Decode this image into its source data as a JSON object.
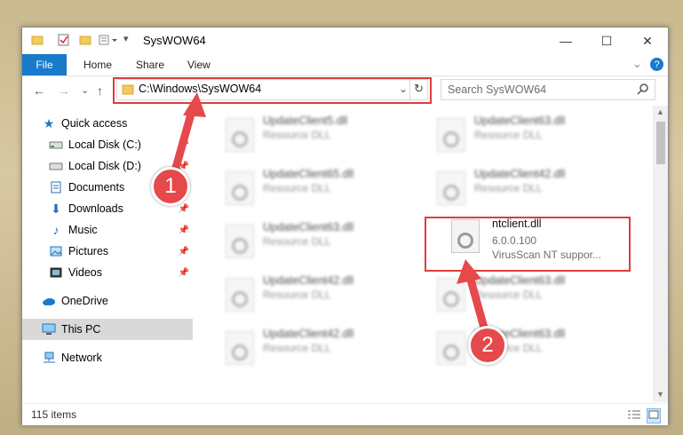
{
  "window": {
    "title": "SysWOW64",
    "minimize_symbol": "—",
    "maximize_symbol": "☐",
    "close_symbol": "✕"
  },
  "ribbon": {
    "file_tab": "File",
    "tabs": [
      "Home",
      "Share",
      "View"
    ],
    "expand_symbol": "⌄",
    "help_symbol": "?"
  },
  "nav": {
    "back_symbol": "←",
    "forward_symbol": "→",
    "recent_symbol": "⌄",
    "up_symbol": "↑",
    "address": "C:\\Windows\\SysWOW64",
    "dropdown_symbol": "⌄",
    "refresh_symbol": "↻",
    "search_placeholder": "Search SysWOW64"
  },
  "sidebar": {
    "items": [
      {
        "label": "Quick access",
        "icon": "star-icon",
        "pinned": false
      },
      {
        "label": "Local Disk (C:)",
        "icon": "drive-icon",
        "pinned": true
      },
      {
        "label": "Local Disk (D:)",
        "icon": "drive-icon",
        "pinned": true
      },
      {
        "label": "Documents",
        "icon": "documents-icon",
        "pinned": true
      },
      {
        "label": "Downloads",
        "icon": "downloads-icon",
        "pinned": true
      },
      {
        "label": "Music",
        "icon": "music-icon",
        "pinned": true
      },
      {
        "label": "Pictures",
        "icon": "pictures-icon",
        "pinned": true
      },
      {
        "label": "Videos",
        "icon": "videos-icon",
        "pinned": true
      },
      {
        "label": "OneDrive",
        "icon": "cloud-icon",
        "pinned": false
      },
      {
        "label": "This PC",
        "icon": "computer-icon",
        "pinned": false,
        "selected": true
      },
      {
        "label": "Network",
        "icon": "network-icon",
        "pinned": false
      }
    ]
  },
  "files": [
    {
      "name": "UpdateClient5.dll",
      "desc": "Resource DLL"
    },
    {
      "name": "UpdateClient63.dll",
      "desc": "Resource DLL"
    },
    {
      "name": "UpdateClient65.dll",
      "desc": "Resource DLL"
    },
    {
      "name": "UpdateClient42.dll",
      "desc": "Resource DLL"
    },
    {
      "name": "UpdateClient63.dll",
      "desc": "Resource DLL"
    },
    {
      "name": "ntclient.dll",
      "version": "6.0.0.100",
      "desc": "VirusScan NT suppor..."
    },
    {
      "name": "UpdateClient42.dll",
      "desc": "Resource DLL"
    },
    {
      "name": "UpdateClient63.dll",
      "desc": "Resource DLL"
    },
    {
      "name": "UpdateClient42.dll",
      "desc": "Resource DLL"
    },
    {
      "name": "UpdateClient63.dll",
      "desc": "Resource DLL"
    }
  ],
  "status": {
    "item_count": "115 items"
  },
  "annotations": {
    "step1": "1",
    "step2": "2",
    "color": "#e03c3c"
  }
}
